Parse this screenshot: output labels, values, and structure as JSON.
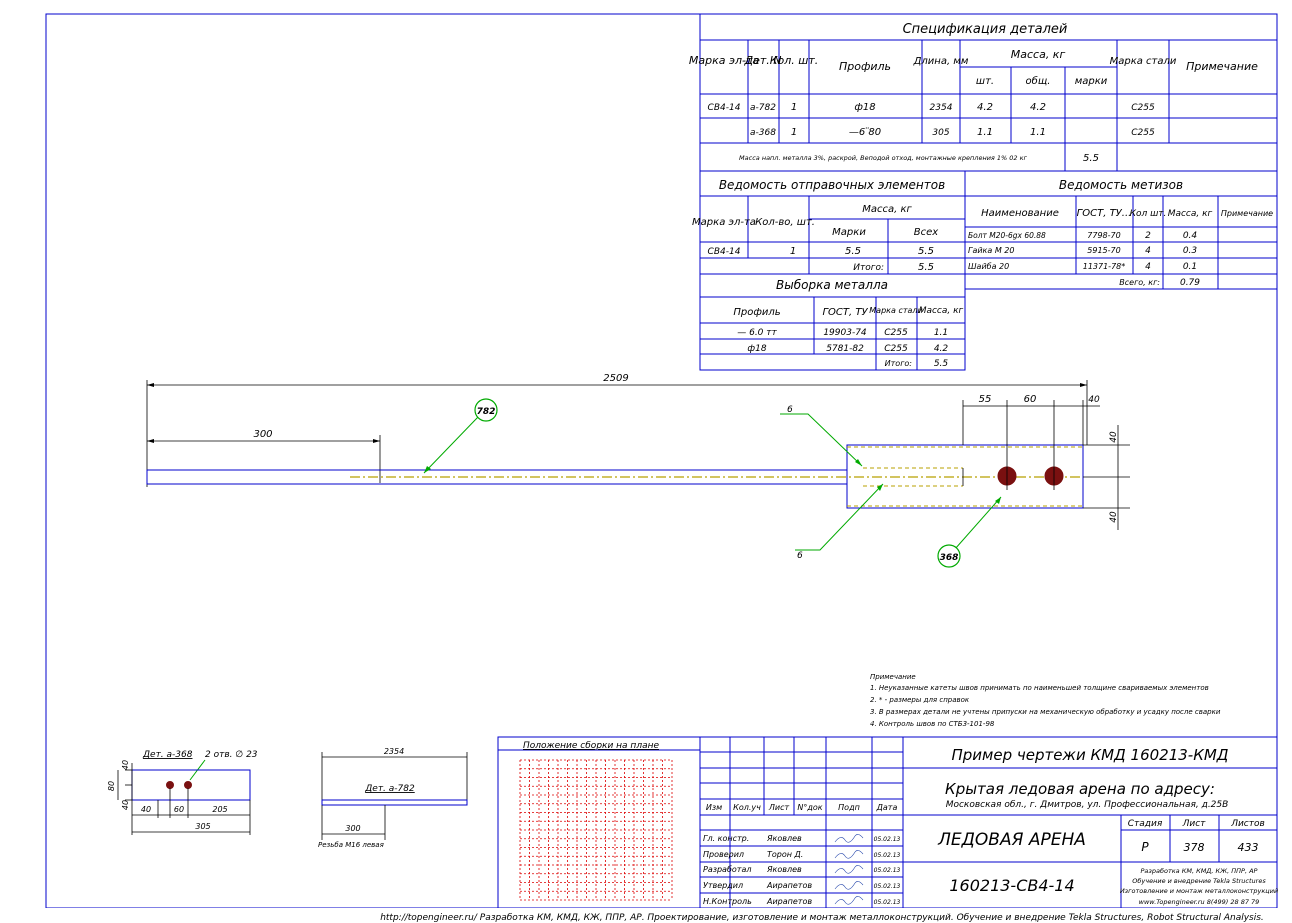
{
  "spec": {
    "title": "Спецификация деталей",
    "headers": {
      "mark": "Марка эл-та",
      "det": "Дет. N",
      "qty": "Кол. шт.",
      "profile": "Профиль",
      "length": "Длина, мм",
      "mass": "Масса, кг",
      "mass_pc": "шт.",
      "mass_total": "общ.",
      "mass_mark": "марки",
      "steel": "Марка стали",
      "note": "Примечание"
    },
    "rows": [
      {
        "mark": "СВ4-14",
        "det": "а-782",
        "qty": "1",
        "profile": "ф18",
        "length": "2354",
        "mass_pc": "4.2",
        "mass_total": "4.2",
        "steel": "С255"
      },
      {
        "mark": "",
        "det": "а-368",
        "qty": "1",
        "profile": "—6 ̈80",
        "length": "305",
        "mass_pc": "1.1",
        "mass_total": "1.1",
        "steel": "С255"
      }
    ],
    "footer_note": "Масса напл. металла 3%, раскрой, Веподой отход, монтажные крепления 1%   02 кг",
    "mark_mass": "5.5"
  },
  "shipping": {
    "title": "Ведомость отправочных элементов",
    "headers": {
      "mark": "Марка эл-та",
      "qty": "Кол-во, шт.",
      "mass": "Масса, кг",
      "mass_mark": "Марки",
      "mass_all": "Всех"
    },
    "rows": [
      {
        "mark": "СВ4-14",
        "qty": "1",
        "mass_mark": "5.5",
        "mass_all": "5.5"
      }
    ],
    "total_label": "Итого:",
    "total": "5.5"
  },
  "hardware": {
    "title": "Ведомость метизов",
    "headers": {
      "name": "Наименование",
      "gost": "ГОСТ, ТУ...",
      "qty": "Кол шт.",
      "mass": "Масса, кг",
      "note": "Примечание"
    },
    "rows": [
      {
        "name": "Болт М20-6gх 60.88",
        "gost": "7798-70",
        "qty": "2",
        "mass": "0.4"
      },
      {
        "name": "Гайка М 20",
        "gost": "5915-70",
        "qty": "4",
        "mass": "0.3"
      },
      {
        "name": "Шайба 20",
        "gost": "11371-78*",
        "qty": "4",
        "mass": "0.1"
      }
    ],
    "total_label": "Всего, кг:",
    "total": "0.79"
  },
  "metal": {
    "title": "Выборка металла",
    "headers": {
      "profile": "Профиль",
      "gost": "ГОСТ, ТУ",
      "steel": "Марка стали",
      "mass": "Масса, кг"
    },
    "rows": [
      {
        "profile": "— 6.0 тт",
        "gost": "19903-74",
        "steel": "С255",
        "mass": "1.1"
      },
      {
        "profile": "ф18",
        "gost": "5781-82",
        "steel": "С255",
        "mass": "4.2"
      }
    ],
    "total_label": "Итого:",
    "total": "5.5"
  },
  "drawing": {
    "dim_total": "2509",
    "dim_left": "300",
    "dim_55": "55",
    "dim_60": "60",
    "dim_40_top": "40",
    "dim_40_r1": "40",
    "dim_40_r2": "40",
    "weld_top": "6",
    "weld_bottom": "6",
    "callout_782": "782",
    "callout_368": "368"
  },
  "det368": {
    "title": "Дет. а-368",
    "holes": "2 отв. ∅ 23",
    "d40a": "40",
    "d80": "80",
    "d40b": "40",
    "d40c": "40",
    "d60": "60",
    "d205": "205",
    "d305": "305"
  },
  "det782": {
    "dim_top": "2354",
    "title": "Дет. а-782",
    "dim_300": "300",
    "thread": "Резьба М16 левая"
  },
  "notes": {
    "title": "Примечание",
    "items": [
      "1. Неуказанные катеты швов принимать по наименьшей толщине свариваемых элементов",
      "2. * - размеры для справок",
      "3. В размерах детали не учтены припуски на механическую обработку и усадку после сварки",
      "4. Контроль швов по СТБ3-101-98"
    ]
  },
  "title_block": {
    "plan_title": "Положение сборки на плане",
    "rev_headers": [
      "Изм",
      "Кол.уч",
      "Лист",
      "N°док",
      "Подп",
      "Дата"
    ],
    "signers": [
      {
        "role": "Гл. констр.",
        "name": "Яковлев",
        "date": "05.02.13"
      },
      {
        "role": "Проверил",
        "name": "Торон Д.",
        "date": "05.02.13"
      },
      {
        "role": "Разработал",
        "name": "Яковлев",
        "date": "05.02.13"
      },
      {
        "role": "Утвердил",
        "name": "Аирапетов",
        "date": "05.02.13"
      },
      {
        "role": "Н.Контроль",
        "name": "Аирапетов",
        "date": "05.02.13"
      }
    ],
    "project": "Пример чертежи КМД   160213-КМД",
    "object": "Крытая ледовая арена по адресу:",
    "address": "Московская обл., г. Дмитров, ул. Профессиональная, д.25В",
    "building": "ЛЕДОВАЯ АРЕНА",
    "stage_label": "Стадия",
    "sheet_label": "Лист",
    "sheets_label": "Листов",
    "stage": "Р",
    "sheet": "378",
    "sheets": "433",
    "drawing_code": "160213-СВ4-14",
    "company": [
      "Разработка КМ, КМД, КЖ, ППР, АР",
      "Обучение и внедрение Tekla Structures",
      "Изготовление и монтаж металлоконструкций",
      "www.Topengineer.ru          8(499) 28 87 79"
    ]
  },
  "footer": "http://topengineer.ru/  Разработка КМ, КМД, КЖ, ППР, АР. Проектирование, изготовление и монтаж металлоконструкций. Обучение и внедрение Tekla Structures, Robot Structural Analysis."
}
